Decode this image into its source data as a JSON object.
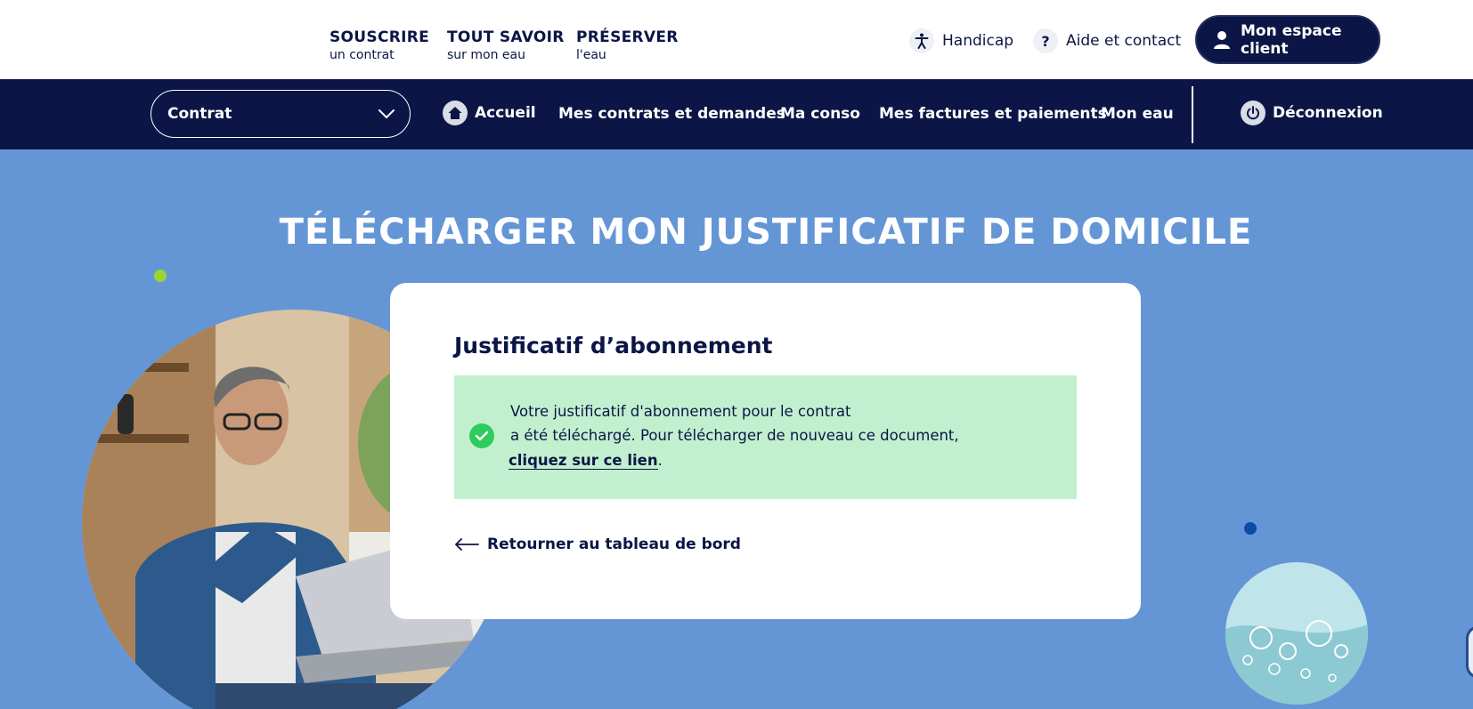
{
  "header": {
    "top_nav": [
      {
        "main": "SOUSCRIRE",
        "sub": "un contrat"
      },
      {
        "main": "TOUT SAVOIR",
        "sub": "sur mon eau"
      },
      {
        "main": "PRÉSERVER",
        "sub": "l'eau"
      }
    ],
    "handicap_label": "Handicap",
    "help_label": "Aide et contact",
    "client_button_label": "Mon espace client"
  },
  "nav": {
    "contract_select_value": "Contrat",
    "home_label": "Accueil",
    "contracts_label": "Mes contrats et demandes",
    "conso_label": "Ma conso",
    "invoices_label": "Mes factures et paiements",
    "water_label": "Mon eau",
    "logout_label": "Déconnexion"
  },
  "page": {
    "title": "TÉLÉCHARGER MON JUSTIFICATIF DE DOMICILE"
  },
  "card": {
    "title": "Justificatif d’abonnement",
    "alert_line1": "Votre justificatif d'abonnement pour le contrat",
    "alert_line2": "a été téléchargé. Pour télécharger de nouveau ce document,",
    "alert_link": "cliquez sur ce lien",
    "alert_end": ".",
    "back_label": "Retourner au tableau de bord"
  },
  "colors": {
    "navy": "#0b1646",
    "page_bg": "#6496d6",
    "success_bg": "#c2f0cf",
    "success_icon": "#2ecc5c",
    "accent_green": "#9ad534",
    "accent_blue": "#0e4aa6"
  }
}
